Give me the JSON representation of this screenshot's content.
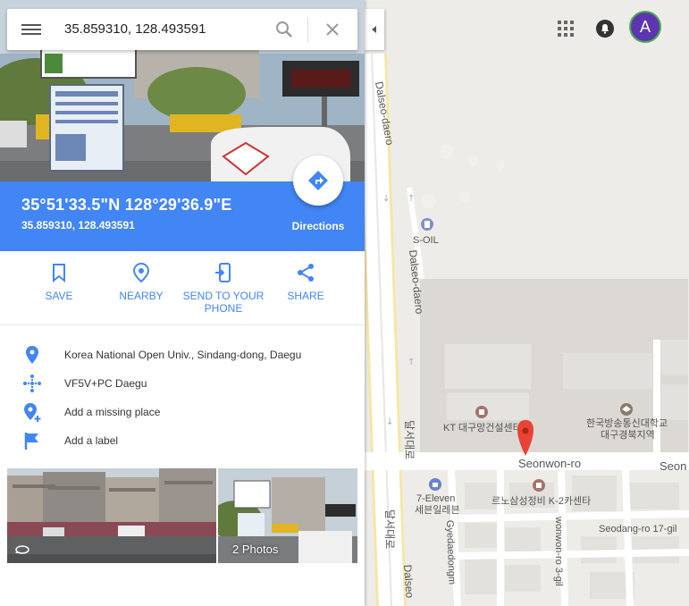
{
  "search": {
    "value": "35.859310, 128.493591"
  },
  "place": {
    "title": "35°51'33.5\"N 128°29'36.9\"E",
    "subtitle": "35.859310, 128.493591",
    "directions_label": "Directions"
  },
  "actions": [
    {
      "label": "SAVE",
      "icon": "bookmark-icon"
    },
    {
      "label": "NEARBY",
      "icon": "nearby-pin-icon"
    },
    {
      "label": "SEND TO YOUR PHONE",
      "icon": "send-to-phone-icon"
    },
    {
      "label": "SHARE",
      "icon": "share-icon"
    }
  ],
  "info": [
    {
      "text": "Korea National Open Univ., Sindang-dong, Daegu",
      "icon": "location-pin-icon"
    },
    {
      "text": "VF5V+PC Daegu",
      "icon": "plus-code-icon"
    },
    {
      "text": "Add a missing place",
      "icon": "add-place-icon"
    },
    {
      "text": "Add a label",
      "icon": "flag-icon"
    }
  ],
  "photos": {
    "count_label": "2 Photos"
  },
  "account": {
    "initial": "A"
  },
  "map_labels": {
    "road_dalseo_daero_1": "Dalseo-daero",
    "road_dalseo_daero_2": "Dalseo-daero",
    "road_dalseo_daero_3": "Dalseo",
    "road_dalseodae_ko_1": "달서대로",
    "road_dalseodae_ko_2": "달서대로",
    "soil": "S-OIL",
    "kt": "KT 대구망건설센터",
    "knou_1": "한국방송통신대학교",
    "knou_2": "대구경북지역",
    "seonwon_ro": "Seonwon-ro",
    "seonwon_ro_2": "Seon",
    "seven_eleven_1": "7-Eleven",
    "seven_eleven_2": "세븐일레븐",
    "k2": "르노삼성정비 K-2카센타",
    "seodang_ro": "Seodang-ro 17-gil",
    "gyedaedong": "Gyedaedongm",
    "seonwon_3gil": "wonwon-ro 3-gil"
  },
  "colors": {
    "accent": "#4285f4",
    "pin": "#ea4335",
    "road": "#ffffff",
    "map_bg": "#eeece8",
    "building": "#dcd9d4",
    "highway_edge": "#f6e6a8"
  }
}
